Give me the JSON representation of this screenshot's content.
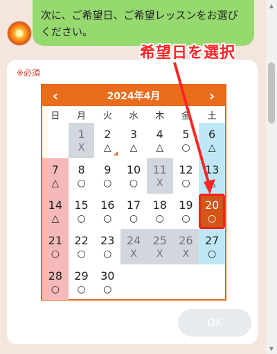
{
  "message": {
    "text": "次に、ご希望日、ご希望レッスンをお選びください。"
  },
  "form": {
    "required_label": "※必須",
    "ok_label": "OK"
  },
  "calendar": {
    "title": "2024年4月",
    "prev_icon": "chevron-left-icon",
    "next_icon": "chevron-right-icon",
    "weekdays": [
      "日",
      "月",
      "火",
      "水",
      "木",
      "金",
      "土"
    ],
    "accent_color": "#ea6d1c",
    "selected_day": "20",
    "days": [
      {
        "day": "",
        "mark": ""
      },
      {
        "day": "1",
        "mark": "X",
        "status": "closed"
      },
      {
        "day": "2",
        "mark": "△",
        "status": "open",
        "corner_marker": true
      },
      {
        "day": "3",
        "mark": "△",
        "status": "open"
      },
      {
        "day": "4",
        "mark": "△",
        "status": "open"
      },
      {
        "day": "5",
        "mark": "○",
        "status": "open"
      },
      {
        "day": "6",
        "mark": "△",
        "status": "open"
      },
      {
        "day": "7",
        "mark": "△",
        "status": "open"
      },
      {
        "day": "8",
        "mark": "○",
        "status": "open"
      },
      {
        "day": "9",
        "mark": "○",
        "status": "open"
      },
      {
        "day": "10",
        "mark": "○",
        "status": "open"
      },
      {
        "day": "11",
        "mark": "X",
        "status": "closed"
      },
      {
        "day": "12",
        "mark": "○",
        "status": "open"
      },
      {
        "day": "13",
        "mark": "△",
        "status": "open"
      },
      {
        "day": "14",
        "mark": "△",
        "status": "open"
      },
      {
        "day": "15",
        "mark": "○",
        "status": "open"
      },
      {
        "day": "16",
        "mark": "○",
        "status": "open"
      },
      {
        "day": "17",
        "mark": "○",
        "status": "open"
      },
      {
        "day": "18",
        "mark": "○",
        "status": "open"
      },
      {
        "day": "19",
        "mark": "○",
        "status": "open"
      },
      {
        "day": "20",
        "mark": "○",
        "status": "selected"
      },
      {
        "day": "21",
        "mark": "○",
        "status": "open"
      },
      {
        "day": "22",
        "mark": "○",
        "status": "open"
      },
      {
        "day": "23",
        "mark": "○",
        "status": "open"
      },
      {
        "day": "24",
        "mark": "X",
        "status": "closed"
      },
      {
        "day": "25",
        "mark": "X",
        "status": "closed"
      },
      {
        "day": "26",
        "mark": "X",
        "status": "closed"
      },
      {
        "day": "27",
        "mark": "○",
        "status": "open"
      },
      {
        "day": "28",
        "mark": "○",
        "status": "open"
      },
      {
        "day": "29",
        "mark": "○",
        "status": "open"
      },
      {
        "day": "30",
        "mark": "○",
        "status": "open"
      },
      {
        "day": "",
        "mark": ""
      },
      {
        "day": "",
        "mark": ""
      },
      {
        "day": "",
        "mark": ""
      },
      {
        "day": "",
        "mark": ""
      }
    ]
  },
  "annotation": {
    "text": "希望日を選択",
    "color": "#ff2525"
  }
}
